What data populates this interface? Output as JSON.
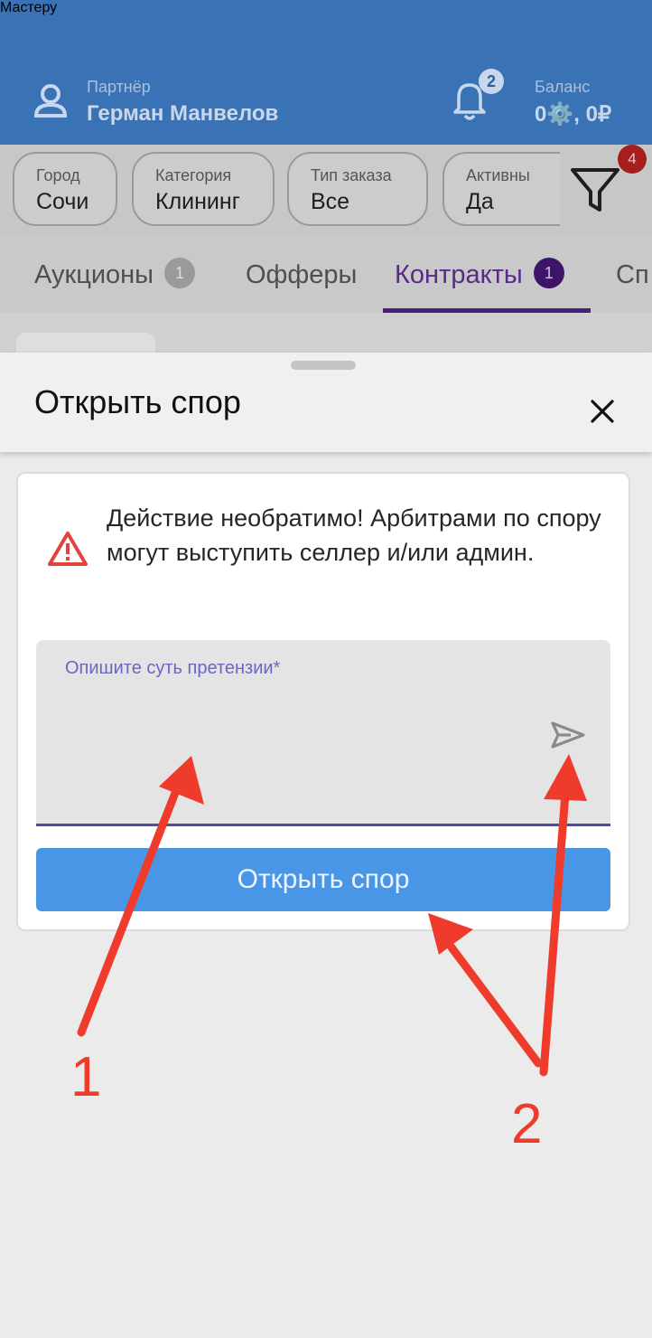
{
  "header": {
    "title": "Мастеру",
    "partner_caption": "Партнёр",
    "partner_name": "Герман Манвелов",
    "notifications_count": "2",
    "balance_caption": "Баланс",
    "balance_value": "0⚙️, 0₽"
  },
  "filters": {
    "chips": [
      {
        "caption": "Город",
        "value": "Сочи"
      },
      {
        "caption": "Категория",
        "value": "Клининг"
      },
      {
        "caption": "Тип заказа",
        "value": "Все"
      },
      {
        "caption": "Активны",
        "value": "Да"
      }
    ],
    "filter_badge": "4"
  },
  "tabs": [
    {
      "label": "Аукционы",
      "badge": "1"
    },
    {
      "label": "Офферы"
    },
    {
      "label": "Контракты",
      "badge": "1",
      "active": true
    },
    {
      "label": "Сп"
    }
  ],
  "sheet": {
    "title": "Открыть спор",
    "warning": "Действие необратимо! Арбитрами по спору могут выступить селлер и/или админ.",
    "input_label": "Опишите суть претензии*",
    "submit_label": "Открыть спор"
  },
  "annotations": {
    "label_1": "1",
    "label_2": "2"
  },
  "colors": {
    "header_bg": "#3a72b6",
    "active_tab": "#4a1e7c",
    "submit_button": "#4a96e6",
    "annotation_red": "#ef3b2b",
    "warning_red": "#e0443a"
  }
}
